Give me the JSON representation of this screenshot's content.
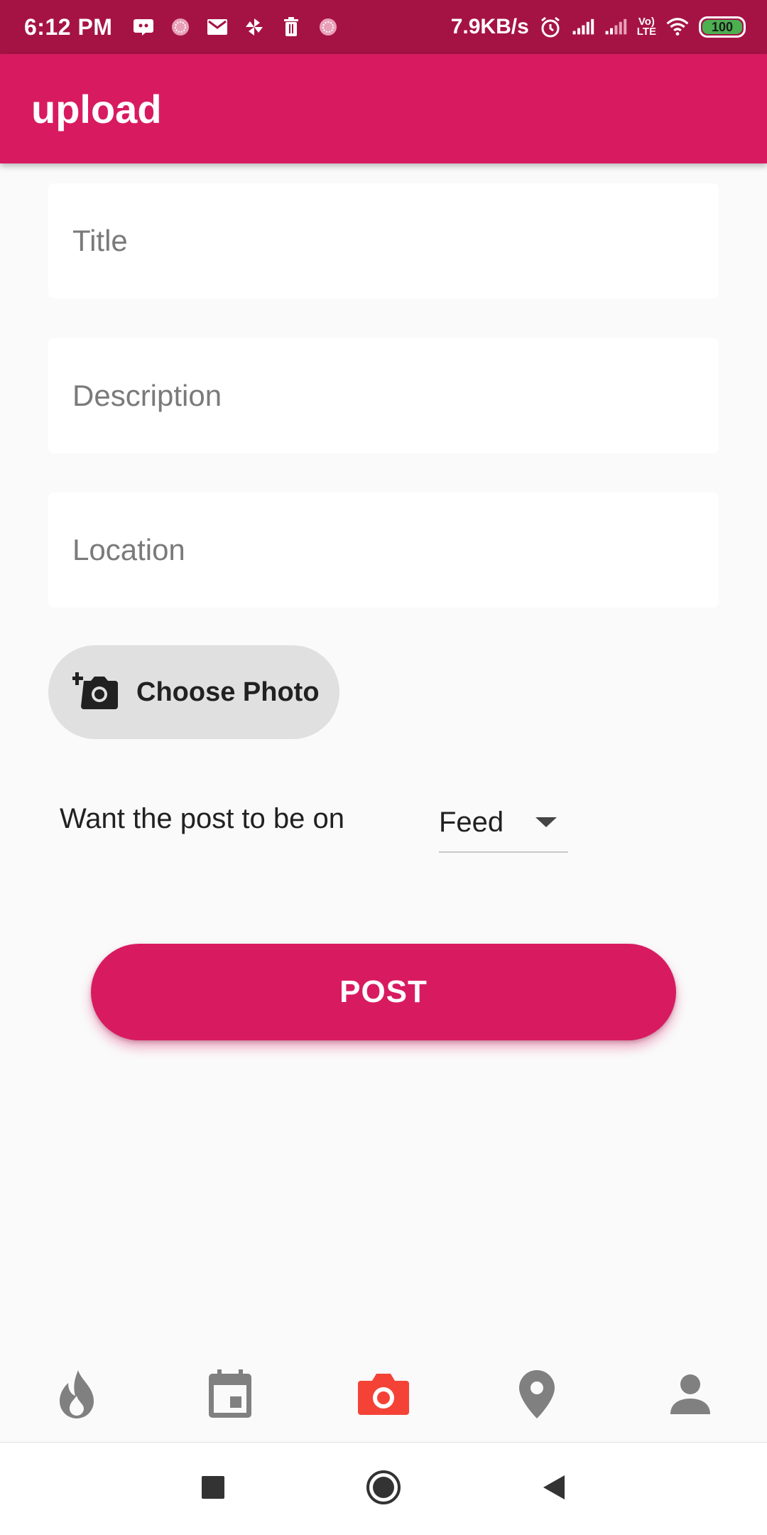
{
  "status_bar": {
    "time": "6:12 PM",
    "network_speed": "7.9KB/s",
    "battery_level": "100",
    "volte_label_1": "Vo)",
    "volte_label_2": "LTE",
    "icons_left": [
      "discord-icon",
      "app-icon",
      "gmail-icon",
      "pinwheel-icon",
      "trash-icon",
      "app-icon"
    ],
    "icons_right": [
      "alarm-icon",
      "signal-icon",
      "signal-icon",
      "volte-icon",
      "wifi-icon",
      "battery-icon"
    ]
  },
  "app_bar": {
    "title": "upload",
    "color": "#d81b60"
  },
  "form": {
    "title_placeholder": "Title",
    "title_value": "",
    "description_placeholder": "Description",
    "description_value": "",
    "location_placeholder": "Location",
    "location_value": "",
    "choose_photo_label": "Choose Photo",
    "choose_photo_icon": "add-a-photo-icon",
    "destination_label": "Want the post to be on",
    "destination_selected": "Feed",
    "post_button_label": "POST"
  },
  "bottom_nav": {
    "items": [
      {
        "icon": "flame-icon",
        "active": false
      },
      {
        "icon": "calendar-icon",
        "active": false
      },
      {
        "icon": "camera-icon",
        "active": true
      },
      {
        "icon": "location-pin-icon",
        "active": false
      },
      {
        "icon": "person-icon",
        "active": false
      }
    ],
    "active_color": "#f44336",
    "inactive_color": "#808080"
  },
  "system_nav": {
    "buttons": [
      "recents-button",
      "home-button",
      "back-button"
    ]
  }
}
